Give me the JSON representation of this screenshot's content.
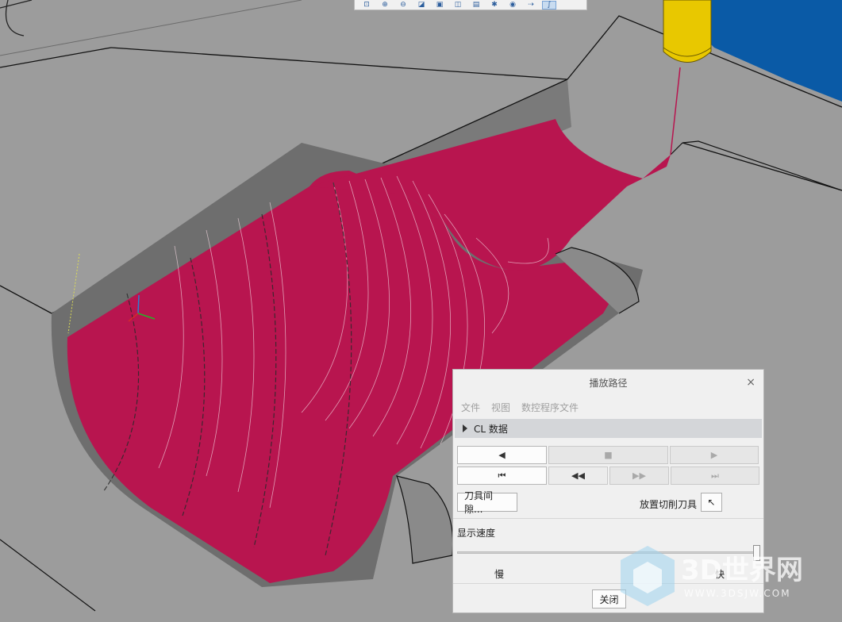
{
  "toolbar": {
    "icons": [
      "zoom-fit-icon",
      "zoom-in-icon",
      "zoom-out-icon",
      "repaint-icon",
      "saved-views-icon",
      "display-style-icon",
      "view-manager-icon",
      "datum-display-icon",
      "annotation-display-icon",
      "spin-center-icon",
      "toolpath-icon"
    ]
  },
  "dialog": {
    "title": "播放路径",
    "close": "×",
    "menu": {
      "file": "文件",
      "view": "视图",
      "nc_file": "数控程序文件"
    },
    "section": "CL 数据",
    "buttons": {
      "play_backward": "◀",
      "stop": "■",
      "play_forward": "▶",
      "rewind_start": "⏮",
      "step_back": "◀◀",
      "step_forward": "▶▶",
      "skip_end": "⏭"
    },
    "clearance_button": "刀具间隙...",
    "place_tool_label": "放置切削刀具",
    "place_tool_icon": "↖",
    "speed_label": "显示速度",
    "slow": "慢",
    "fast": "快",
    "speed_value": 1.0,
    "close_button": "关闭"
  },
  "watermark": {
    "brand": "3D世界网",
    "url": "WWW.3DSJW.COM"
  },
  "colors": {
    "toolpath": "#b8154f",
    "tool_holder": "#e8c800",
    "part": "#9c9c9c",
    "background": "#0a5aa6"
  }
}
